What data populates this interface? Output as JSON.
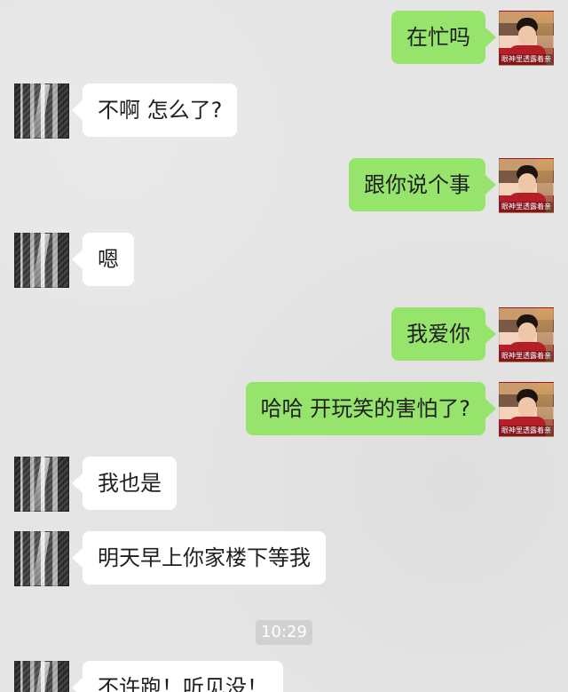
{
  "messages": [
    {
      "side": "right",
      "text": "在忙吗"
    },
    {
      "side": "left",
      "text": "不啊  怎么了?"
    },
    {
      "side": "right",
      "text": "跟你说个事"
    },
    {
      "side": "left",
      "text": "嗯"
    },
    {
      "side": "right",
      "text": "我爱你"
    },
    {
      "side": "right",
      "text": "哈哈  开玩笑的害怕了?"
    },
    {
      "side": "left",
      "text": "我也是"
    },
    {
      "side": "left",
      "text": "明天早上你家楼下等我"
    },
    {
      "side": "left",
      "text": "不许跑！听见没！"
    }
  ],
  "timestamp": "10:29",
  "avatars": {
    "left_icon": "street-photo-avatar",
    "right_icon": "boy-photo-avatar",
    "right_caption": "眼神里透露着亲"
  },
  "colors": {
    "background": "#e5e5e5",
    "incoming_bubble": "#ffffff",
    "outgoing_bubble": "#96e46b",
    "timestamp_bg": "#d1d1d1"
  }
}
